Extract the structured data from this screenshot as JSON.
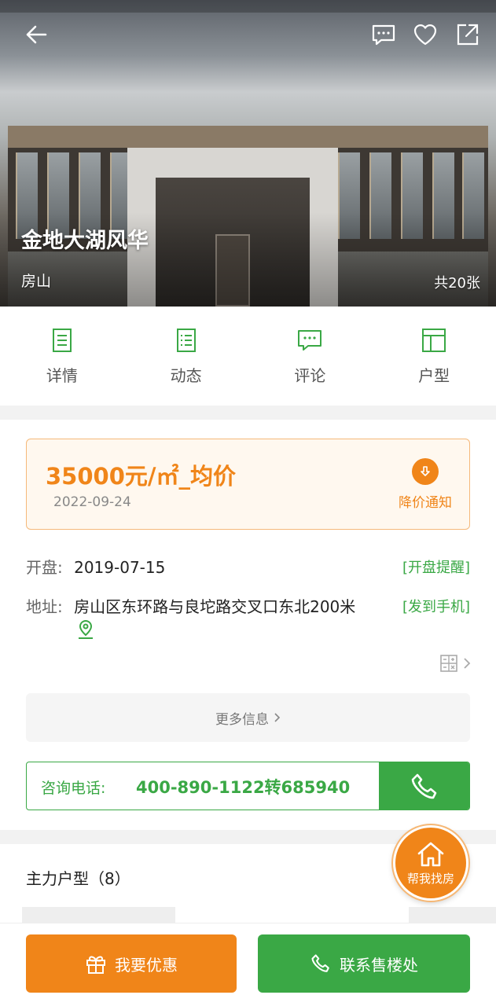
{
  "hero": {
    "title": "金地大湖风华",
    "district": "房山",
    "photo_count": "共20张"
  },
  "header_icons": [
    "back-arrow-icon",
    "message-icon",
    "heart-icon",
    "share-icon"
  ],
  "tabs": [
    {
      "label": "详情",
      "icon": "detail-icon"
    },
    {
      "label": "动态",
      "icon": "news-icon"
    },
    {
      "label": "评论",
      "icon": "comment-icon"
    },
    {
      "label": "户型",
      "icon": "layout-icon"
    }
  ],
  "price": {
    "value": "35000元/㎡_均价",
    "date": "2022-09-24",
    "notify_label": "降价通知"
  },
  "opening": {
    "label": "开盘:",
    "value": "2019-07-15",
    "action": "[开盘提醒]"
  },
  "address": {
    "label": "地址:",
    "value": "房山区东环路与良坨路交叉口东北200米",
    "action": "[发到手机]"
  },
  "more_info": "更多信息",
  "consult": {
    "label": "咨询电话:",
    "number": "400-890-1122转685940"
  },
  "main_plans": {
    "title": "主力户型（8）"
  },
  "fab": {
    "label": "帮我找房"
  },
  "bottom_bar": {
    "discount_label": "我要优惠",
    "contact_label": "联系售楼处"
  },
  "colors": {
    "green": "#3aa845",
    "orange": "#f08519"
  }
}
